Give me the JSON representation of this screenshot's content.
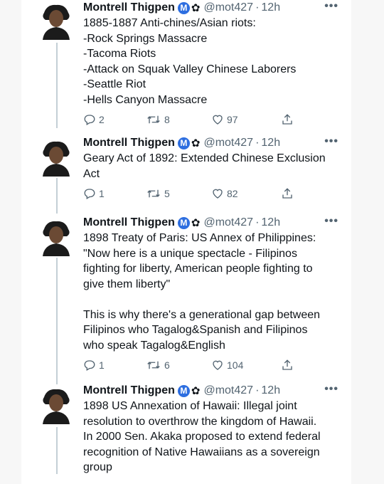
{
  "tweets": [
    {
      "author": "Montrell Thigpen",
      "badge_letter": "M",
      "handle": "@mot427",
      "time": "12h",
      "text": "1885-1887 Anti-chines/Asian riots:\n-Rock Springs Massacre\n-Tacoma Riots\n-Attack on Squak Valley Chinese Laborers\n-Seattle Riot\n-Hells Canyon Massacre",
      "replies": "2",
      "retweets": "8",
      "likes": "97"
    },
    {
      "author": "Montrell Thigpen",
      "badge_letter": "M",
      "handle": "@mot427",
      "time": "12h",
      "text": "Geary Act of 1892: Extended Chinese Exclusion\nAct",
      "replies": "1",
      "retweets": "5",
      "likes": "82"
    },
    {
      "author": "Montrell Thigpen",
      "badge_letter": "M",
      "handle": "@mot427",
      "time": "12h",
      "text": "1898 Treaty of Paris: US Annex of Philippines:\n\"Now here is a unique spectacle - Filipinos\nfighting for liberty, American people fighting to\ngive them liberty\"\n\nThis is why there's a generational gap between\nFilipinos who Tagalog&Spanish and Filipinos\nwho speak Tagalog&English",
      "replies": "1",
      "retweets": "6",
      "likes": "104"
    },
    {
      "author": "Montrell Thigpen",
      "badge_letter": "M",
      "handle": "@mot427",
      "time": "12h",
      "text": "1898 US Annexation of Hawaii: Illegal joint\nresolution to overthrow the kingdom of Hawaii.\nIn 2000 Sen. Akaka proposed to extend federal\nrecognition of Native Hawaiians as a sovereign\ngroup"
    }
  ],
  "colors": {
    "accent": "#2d6ee0",
    "secondary_text": "#536471",
    "thread_line": "#c4cfd6"
  },
  "icons": [
    "more-icon",
    "reply-icon",
    "retweet-icon",
    "like-icon",
    "share-icon"
  ]
}
